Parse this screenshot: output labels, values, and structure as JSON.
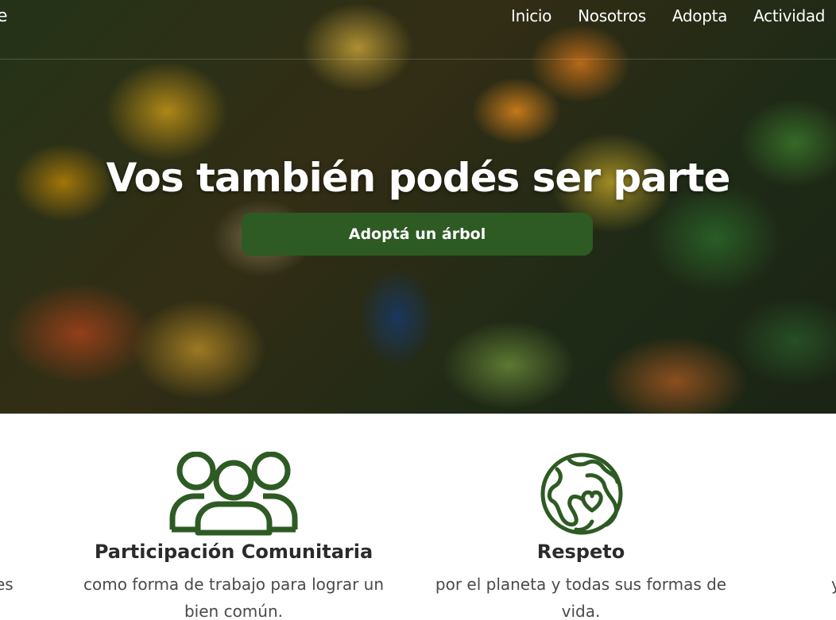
{
  "nav": {
    "brand_fragment": "e",
    "items": [
      {
        "label": "Inicio"
      },
      {
        "label": "Nosotros"
      },
      {
        "label": "Adopta"
      },
      {
        "label": "Actividad"
      }
    ]
  },
  "hero": {
    "title": "Vos también podés ser parte",
    "cta_label": "Adoptá un árbol"
  },
  "values": {
    "left_edge_text": "es",
    "right_edge_text": "y",
    "items": [
      {
        "icon": "community-icon",
        "title": "Participación Comunitaria",
        "description": "como forma de trabajo para lograr un bien común."
      },
      {
        "icon": "planet-heart-icon",
        "title": "Respeto",
        "description": "por el planeta y todas sus formas de vida."
      }
    ]
  },
  "colors": {
    "brand_green": "#2e5a23",
    "icon_green": "#2e5a23",
    "text_dark": "#2b2b2b",
    "text_body": "#4a4a4a"
  }
}
